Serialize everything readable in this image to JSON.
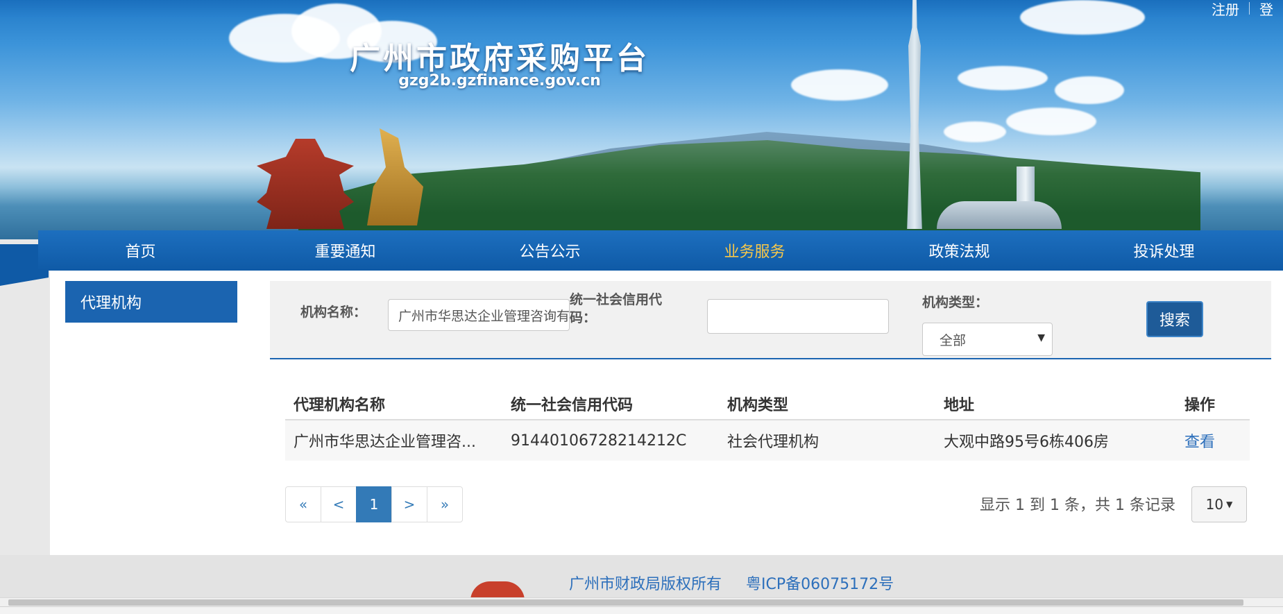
{
  "header": {
    "site_title": "广州市政府采购平台",
    "site_domain": "gzg2b.gzfinance.gov.cn",
    "register_link": "注册",
    "login_link": "登"
  },
  "nav": {
    "items": [
      {
        "label": "首页"
      },
      {
        "label": "重要通知"
      },
      {
        "label": "公告公示"
      },
      {
        "label": "业务服务"
      },
      {
        "label": "政策法规"
      },
      {
        "label": "投诉处理"
      }
    ],
    "active_index": 3
  },
  "sidebar": {
    "items": [
      {
        "label": "代理机构"
      }
    ]
  },
  "search": {
    "org_name_label": "机构名称：",
    "org_name_value": "广州市华思达企业管理咨询有限公司",
    "credit_code_label": "统一社会信用代码：",
    "credit_code_value": "",
    "org_type_label": "机构类型：",
    "org_type_selected": "全部",
    "search_button": "搜索"
  },
  "table": {
    "headers": [
      "代理机构名称",
      "统一社会信用代码",
      "机构类型",
      "地址",
      "操作"
    ],
    "rows": [
      {
        "name": "广州市华思达企业管理咨...",
        "credit_code": "91440106728214212C",
        "type": "社会代理机构",
        "address": "大观中路95号6栋406房",
        "action": "查看"
      }
    ]
  },
  "pagination": {
    "first": "«",
    "prev": "<",
    "current": "1",
    "next": ">",
    "last": "»",
    "records_text": "显示 1 到 1 条，共 1 条记录",
    "page_size": "10"
  },
  "footer": {
    "copyright": "广州市财政局版权所有",
    "icp": "粤ICP备06075172号"
  },
  "colors": {
    "nav_bg": "#1d6fbf",
    "nav_active": "#f7c84a",
    "sidebar_active": "#1b64b0",
    "link": "#2c6fbb"
  }
}
